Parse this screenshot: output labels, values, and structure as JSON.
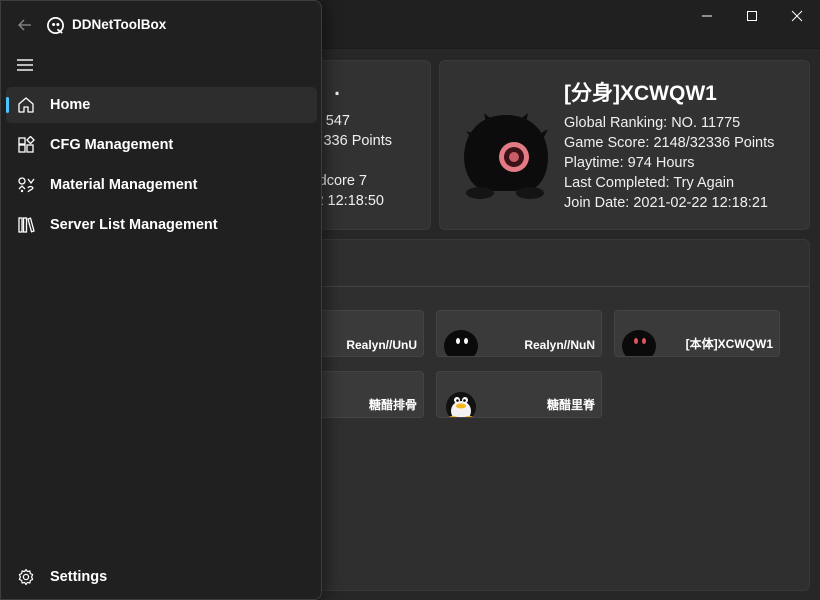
{
  "app": {
    "title": "DDNetToolBox"
  },
  "window": {
    "minimize_icon": "minimize-icon",
    "maximize_icon": "maximize-icon",
    "close_icon": "close-icon"
  },
  "nav": {
    "items": [
      {
        "label": "Home",
        "icon": "home-icon",
        "active": true
      },
      {
        "label": "CFG Management",
        "icon": "cfg-icon",
        "active": false
      },
      {
        "label": "Material Management",
        "icon": "material-icon",
        "active": false
      },
      {
        "label": "Server List Management",
        "icon": "library-icon",
        "active": false
      }
    ],
    "settings": {
      "label": "Settings",
      "icon": "gear-icon"
    }
  },
  "colors": {
    "accent": "#4cc2ff",
    "background": "#202020",
    "card": "#323232"
  },
  "left_card": {
    "name_fragment": ".",
    "ranking_fragment": "547",
    "score_fragment": "336 Points",
    "last_completed_fragment": "dcore 7",
    "join_fragment": "2 12:18:50"
  },
  "right_card": {
    "name": "[分身]XCWQW1",
    "global_ranking": "Global Ranking: NO. 11775",
    "game_score": "Game Score: 2148/32336 Points",
    "playtime": "Playtime: 974 Hours",
    "last_completed": "Last Completed: Try Again",
    "join_date": "Join Date: 2021-02-22 12:18:21"
  },
  "friends": [
    {
      "name": "Realyn//UnU",
      "avatar": "none"
    },
    {
      "name": "Realyn//NuN",
      "avatar": "black-tee"
    },
    {
      "name": "[本体]XCWQW1",
      "avatar": "red-eye-tee"
    },
    {
      "name": "糖醋排骨",
      "avatar": "none"
    },
    {
      "name": "糖醋里脊",
      "avatar": "penguin"
    }
  ]
}
